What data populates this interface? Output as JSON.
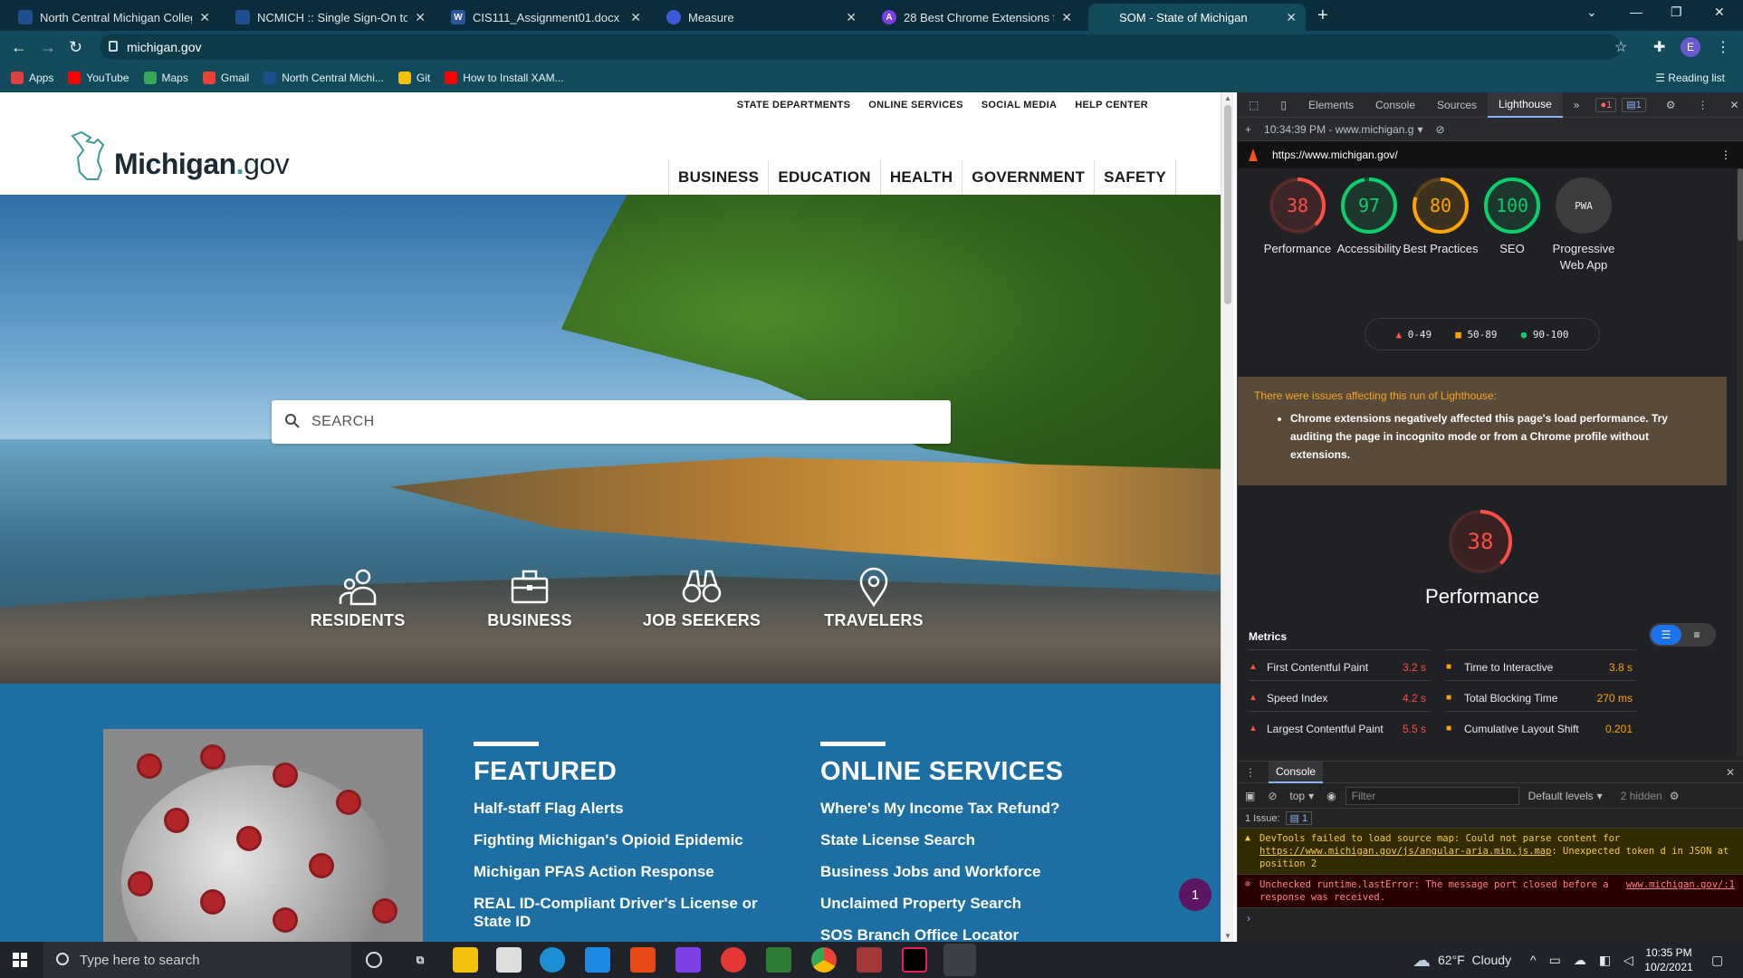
{
  "browser": {
    "tabs": [
      {
        "title": "North Central Michigan College",
        "fav_color": "#1f4e8c",
        "active": false
      },
      {
        "title": "NCMICH :: Single Sign-On to all y",
        "fav_color": "#1f4e8c",
        "active": false
      },
      {
        "title": "CIS111_Assignment01.docx - Mic",
        "fav_color": "#2b579a",
        "fav_text": "W",
        "active": false
      },
      {
        "title": "Measure",
        "fav_color": "#3b5bdb",
        "active": false
      },
      {
        "title": "28 Best Chrome Extensions for W",
        "fav_color": "#7b3fe4",
        "fav_text": "A",
        "active": false
      },
      {
        "title": "SOM - State of Michigan",
        "fav_color": "#124a5c",
        "active": true
      }
    ],
    "url": "michigan.gov",
    "profile_initial": "E",
    "bookmarks": [
      {
        "label": "Apps",
        "color": "#e04040"
      },
      {
        "label": "YouTube",
        "color": "#ff0000"
      },
      {
        "label": "Maps",
        "color": "#34a853"
      },
      {
        "label": "Gmail",
        "color": "#ea4335"
      },
      {
        "label": "North Central Michi...",
        "color": "#1f4e8c"
      },
      {
        "label": "Git",
        "color": "#f4c20d"
      },
      {
        "label": "How to Install XAM...",
        "color": "#ff0000"
      }
    ],
    "reading_list": "Reading list"
  },
  "site": {
    "utility_nav": [
      "STATE DEPARTMENTS",
      "ONLINE SERVICES",
      "SOCIAL MEDIA",
      "HELP CENTER"
    ],
    "logo_word": "Michigan",
    "logo_dot": ".",
    "logo_suffix": "gov",
    "main_nav": [
      "BUSINESS",
      "EDUCATION",
      "HEALTH",
      "GOVERNMENT",
      "SAFETY"
    ],
    "search_placeholder": "SEARCH",
    "hero_links": [
      {
        "label": "RESIDENTS",
        "icon": "residents-icon"
      },
      {
        "label": "BUSINESS",
        "icon": "briefcase-icon"
      },
      {
        "label": "JOB SEEKERS",
        "icon": "binoculars-icon"
      },
      {
        "label": "TRAVELERS",
        "icon": "location-pin-icon"
      }
    ],
    "featured": {
      "title": "FEATURED",
      "links": [
        "Half-staff Flag Alerts",
        "Fighting Michigan's Opioid Epidemic",
        "Michigan PFAS Action Response",
        "REAL ID-Compliant Driver's License or State ID"
      ]
    },
    "online_services": {
      "title": "ONLINE SERVICES",
      "links": [
        "Where's My Income Tax Refund?",
        "State License Search",
        "Business Jobs and Workforce",
        "Unclaimed Property Search",
        "SOS Branch Office Locator"
      ]
    },
    "chat_count": "1"
  },
  "devtools": {
    "tabs": [
      "Elements",
      "Console",
      "Sources",
      "Lighthouse"
    ],
    "active_tab": "Lighthouse",
    "error_count": "1",
    "issue_count": "1",
    "report_time": "10:34:39 PM - www.michigan.g",
    "report_url": "https://www.michigan.gov/",
    "scores": [
      {
        "label": "Performance",
        "value": 38,
        "color": "#ff4e42"
      },
      {
        "label": "Accessibility",
        "value": 97,
        "color": "#0cce6b"
      },
      {
        "label": "Best Practices",
        "value": 80,
        "color": "#ffa400"
      },
      {
        "label": "SEO",
        "value": 100,
        "color": "#0cce6b"
      },
      {
        "label": "Progressive Web App",
        "value": "PWA",
        "color": "#9aa0a6"
      }
    ],
    "legend": [
      "0-49",
      "50-89",
      "90-100"
    ],
    "warning_heading": "There were issues affecting this run of Lighthouse:",
    "warning_item": "Chrome extensions negatively affected this page's load performance. Try auditing the page in incognito mode or from a Chrome profile without extensions.",
    "perf_score": 38,
    "perf_label": "Performance",
    "metrics_label": "Metrics",
    "metrics": [
      {
        "name": "First Contentful Paint",
        "value": "3.2 s",
        "status": "fail"
      },
      {
        "name": "Time to Interactive",
        "value": "3.8 s",
        "status": "average"
      },
      {
        "name": "Speed Index",
        "value": "4.2 s",
        "status": "fail"
      },
      {
        "name": "Total Blocking Time",
        "value": "270 ms",
        "status": "average"
      },
      {
        "name": "Largest Contentful Paint",
        "value": "5.5 s",
        "status": "fail"
      },
      {
        "name": "Cumulative Layout Shift",
        "value": "0.201",
        "status": "average"
      }
    ],
    "console": {
      "tab": "Console",
      "context": "top",
      "filter_placeholder": "Filter",
      "levels": "Default levels",
      "hidden": "2 hidden",
      "issues_label": "1 Issue:",
      "issues_count": "1",
      "warning_msg": "DevTools failed to load source map: Could not parse content for ",
      "warning_link": "https://www.michigan.gov/js/angular-aria.min.js.map",
      "warning_tail": ": Unexpected token d in JSON at position 2",
      "error_msg": "Unchecked runtime.lastError: The message port closed before a response was received.",
      "error_src": "www.michigan.gov/:1"
    }
  },
  "taskbar": {
    "search_placeholder": "Type here to search",
    "weather": "62°F  Cloudy",
    "time": "10:35 PM",
    "date": "10/2/2021"
  }
}
